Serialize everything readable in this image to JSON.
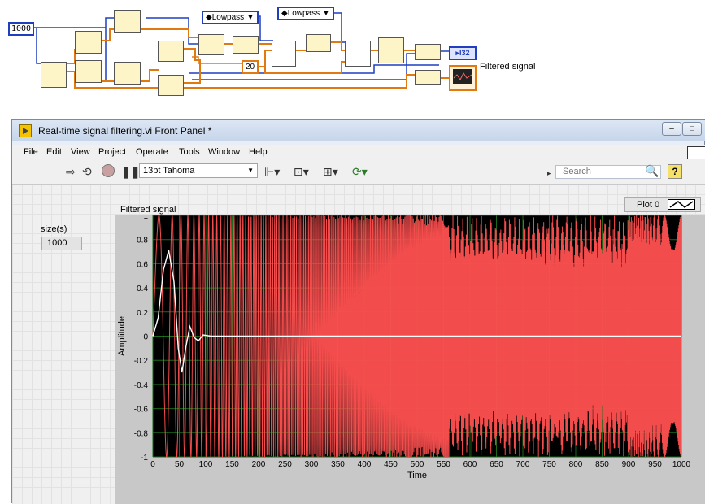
{
  "block_diagram": {
    "size_constant": "1000",
    "order_constant": "20",
    "filter_type_1": "Lowpass",
    "filter_type_2": "Lowpass",
    "output_type": "I32",
    "graph_terminal_label": "Filtered signal"
  },
  "window": {
    "title": "Real-time signal filtering.vi Front Panel *",
    "menu": [
      "File",
      "Edit",
      "View",
      "Project",
      "Operate",
      "Tools",
      "Window",
      "Help"
    ],
    "font_select": "13pt Tahoma",
    "search_placeholder": "Search",
    "help_label": "?"
  },
  "controls": {
    "size_label": "size(s)",
    "size_value": "1000"
  },
  "graph": {
    "label": "Filtered signal",
    "legend_label": "Plot 0"
  },
  "colors": {
    "plot_background": "#000000",
    "grid": "#1a6a1a",
    "raw_signal": "#ff5050",
    "filtered_signal": "#ffffff",
    "wire_orange": "#e07a10",
    "wire_blue": "#1f3fbf"
  },
  "chart_data": {
    "type": "line",
    "title": "",
    "xlabel": "Time",
    "ylabel": "Amplitude",
    "xlim": [
      0,
      1000
    ],
    "ylim": [
      -1,
      1
    ],
    "grid": true,
    "x_ticks": [
      0,
      50,
      100,
      150,
      200,
      250,
      300,
      350,
      400,
      450,
      500,
      550,
      600,
      650,
      700,
      750,
      800,
      850,
      900,
      950,
      1000
    ],
    "y_ticks": [
      1,
      0.8,
      0.6,
      0.4,
      0.2,
      0,
      -0.2,
      -0.4,
      -0.6,
      -0.8,
      -1
    ],
    "x_tick_labels": [
      "0",
      "50",
      "100",
      "150",
      "200",
      "250",
      "300",
      "350",
      "400",
      "450",
      "500",
      "550",
      "600",
      "650",
      "700",
      "750",
      "800",
      "850",
      "900",
      "950",
      "1000"
    ],
    "y_tick_labels": [
      "1",
      "0.8",
      "0.6",
      "0.4",
      "0.2",
      "0",
      "-0.2",
      "-0.4",
      "-0.6",
      "-0.8",
      "-1"
    ],
    "series": [
      {
        "color": "#ff5050",
        "kind": "chirp",
        "amplitude": 1.0,
        "note_visible": false
      },
      {
        "color": "#ffffff",
        "kind": "decaying",
        "points": [
          [
            0,
            0
          ],
          [
            10,
            0.15
          ],
          [
            20,
            0.55
          ],
          [
            30,
            0.71
          ],
          [
            40,
            0.45
          ],
          [
            48,
            -0.1
          ],
          [
            55,
            -0.3
          ],
          [
            62,
            -0.1
          ],
          [
            70,
            0.08
          ],
          [
            78,
            -0.01
          ],
          [
            86,
            -0.04
          ],
          [
            95,
            0.01
          ],
          [
            110,
            0
          ],
          [
            150,
            0
          ],
          [
            1000,
            0
          ]
        ]
      }
    ]
  }
}
